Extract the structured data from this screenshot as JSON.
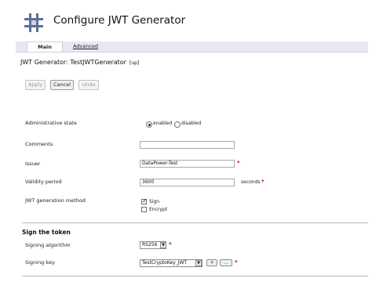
{
  "header": {
    "title": "Configure JWT Generator"
  },
  "tabs": [
    {
      "label": "Main",
      "active": true
    },
    {
      "label": "Advanced",
      "active": false
    }
  ],
  "object": {
    "title": "JWT Generator: TestJWTGenerator",
    "up_link": "[up]"
  },
  "actions": {
    "apply": "Apply",
    "cancel": "Cancel",
    "undo": "Undo"
  },
  "form": {
    "admin_state": {
      "label": "Administrative state",
      "enabled_label": "enabled",
      "disabled_label": "disabled",
      "value": "enabled"
    },
    "comments": {
      "label": "Comments",
      "value": ""
    },
    "issuer": {
      "label": "Issuer",
      "value": "DataPower-Test",
      "required_mark": "*"
    },
    "validity": {
      "label": "Validity period",
      "value": "3600",
      "unit": "seconds",
      "required_mark": "*"
    },
    "method": {
      "label": "JWT generation method",
      "sign_label": "Sign",
      "sign_checked": true,
      "encrypt_label": "Encrypt",
      "encrypt_checked": false
    }
  },
  "sign_section": {
    "title": "Sign the token",
    "algorithm": {
      "label": "Signing algorithm",
      "value": "RS256",
      "required_mark": "*"
    },
    "key": {
      "label": "Signing key",
      "value": "TestCryptoKey_JWT",
      "add": "+",
      "more": "...",
      "required_mark": "*"
    }
  },
  "colors": {
    "tab_bar": "#e6e9f4",
    "required": "#cc0000"
  }
}
